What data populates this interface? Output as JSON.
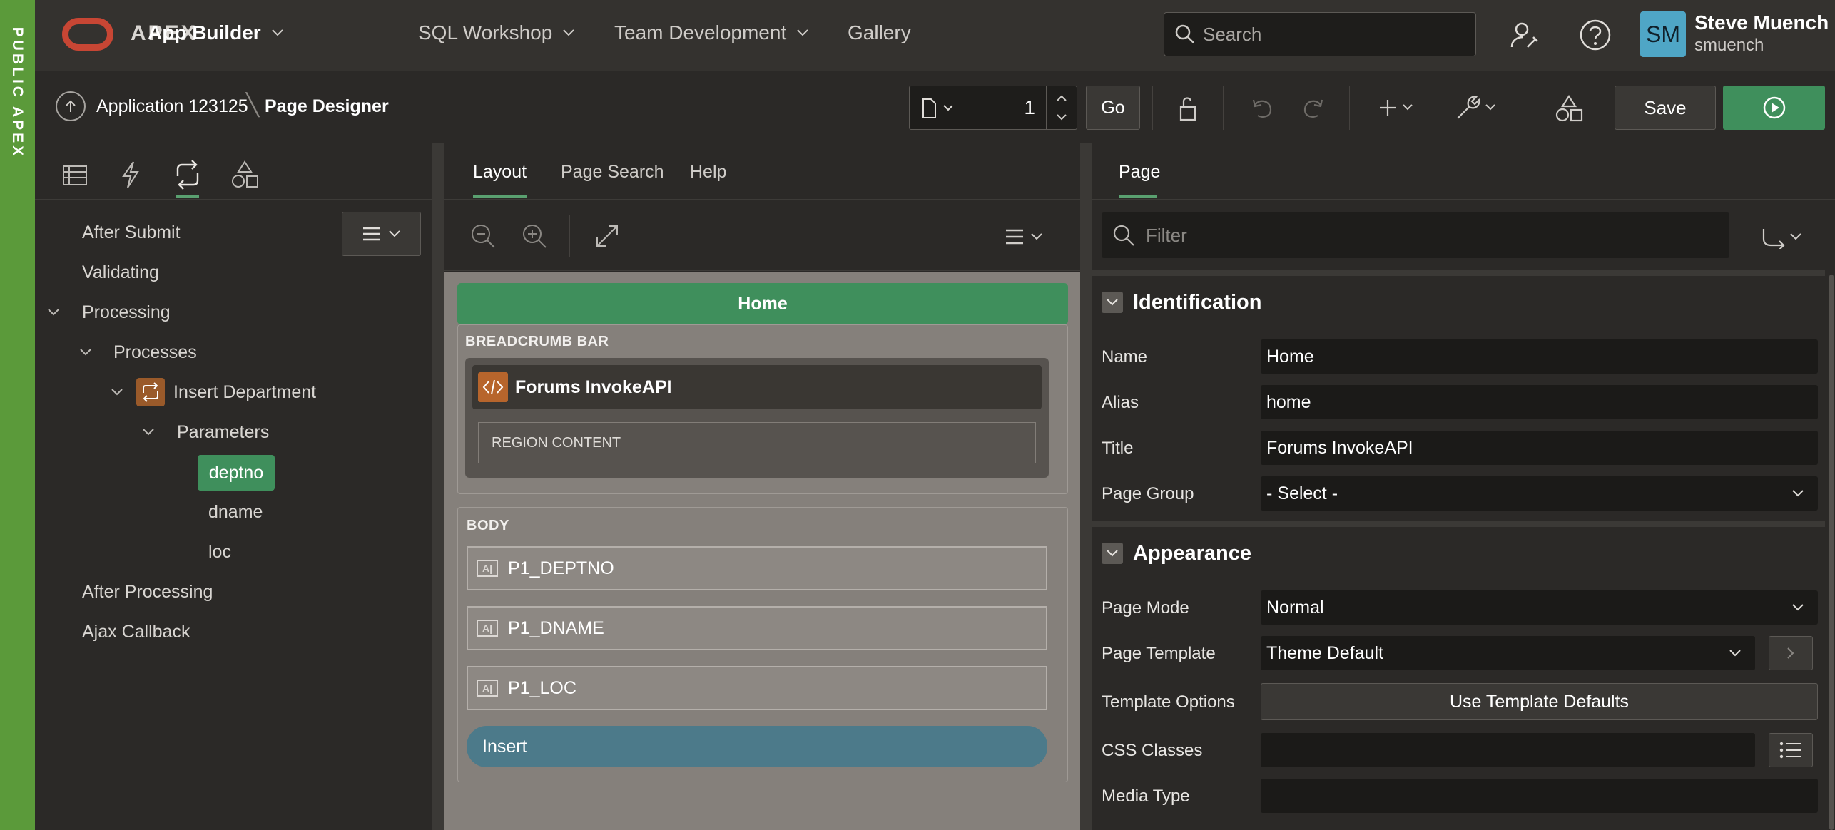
{
  "environment_badge": "PUBLIC APEX",
  "topnav": {
    "brand": "APEX",
    "items": [
      {
        "label": "App Builder",
        "active": true
      },
      {
        "label": "SQL Workshop",
        "active": false
      },
      {
        "label": "Team Development",
        "active": false
      },
      {
        "label": "Gallery",
        "active": false
      }
    ],
    "search_placeholder": "Search",
    "user": {
      "initials": "SM",
      "name": "Steve Muench",
      "username": "smuench"
    }
  },
  "toolbar": {
    "app_crumb": "Application 123125",
    "page_crumb": "Page Designer",
    "page_number": "1",
    "go_label": "Go",
    "save_label": "Save"
  },
  "left_pane": {
    "tabs": [
      "rendering-icon",
      "dynamic-actions-icon",
      "processing-icon",
      "shared-components-icon"
    ],
    "active_tab_index": 2,
    "tree": [
      {
        "label": "After Submit"
      },
      {
        "label": "Validating"
      },
      {
        "label": "Processing"
      },
      {
        "label": "Processes"
      },
      {
        "label": "Insert Department"
      },
      {
        "label": "Parameters"
      },
      {
        "label": "deptno",
        "selected": true
      },
      {
        "label": "dname"
      },
      {
        "label": "loc"
      },
      {
        "label": "After Processing"
      },
      {
        "label": "Ajax Callback"
      }
    ]
  },
  "middle_pane": {
    "tabs": [
      {
        "label": "Layout",
        "active": true
      },
      {
        "label": "Page Search",
        "active": false
      },
      {
        "label": "Help",
        "active": false
      }
    ],
    "canvas": {
      "page_title": "Home",
      "breadcrumb_bar_label": "BREADCRUMB BAR",
      "breadcrumb_region_title": "Forums InvokeAPI",
      "region_content_label": "REGION CONTENT",
      "body_label": "BODY",
      "fields": [
        "P1_DEPTNO",
        "P1_DNAME",
        "P1_LOC"
      ],
      "field_icon_text": "A|",
      "button_label": "Insert"
    }
  },
  "right_pane": {
    "tab": "Page",
    "filter_placeholder": "Filter",
    "sections": {
      "identification": {
        "title": "Identification",
        "name_label": "Name",
        "name_value": "Home",
        "alias_label": "Alias",
        "alias_value": "home",
        "title_label": "Title",
        "title_value": "Forums InvokeAPI",
        "group_label": "Page Group",
        "group_value": "- Select -"
      },
      "appearance": {
        "title": "Appearance",
        "mode_label": "Page Mode",
        "mode_value": "Normal",
        "template_label": "Page Template",
        "template_value": "Theme Default",
        "options_label": "Template Options",
        "options_button": "Use Template Defaults",
        "css_label": "CSS Classes",
        "css_value": "",
        "media_label": "Media Type",
        "media_value": ""
      }
    }
  },
  "colors": {
    "accent_green": "#3f8f5c",
    "badge_green": "#5b9a3a",
    "oracle_red": "#c74634",
    "avatar_blue": "#4fa6c6"
  }
}
